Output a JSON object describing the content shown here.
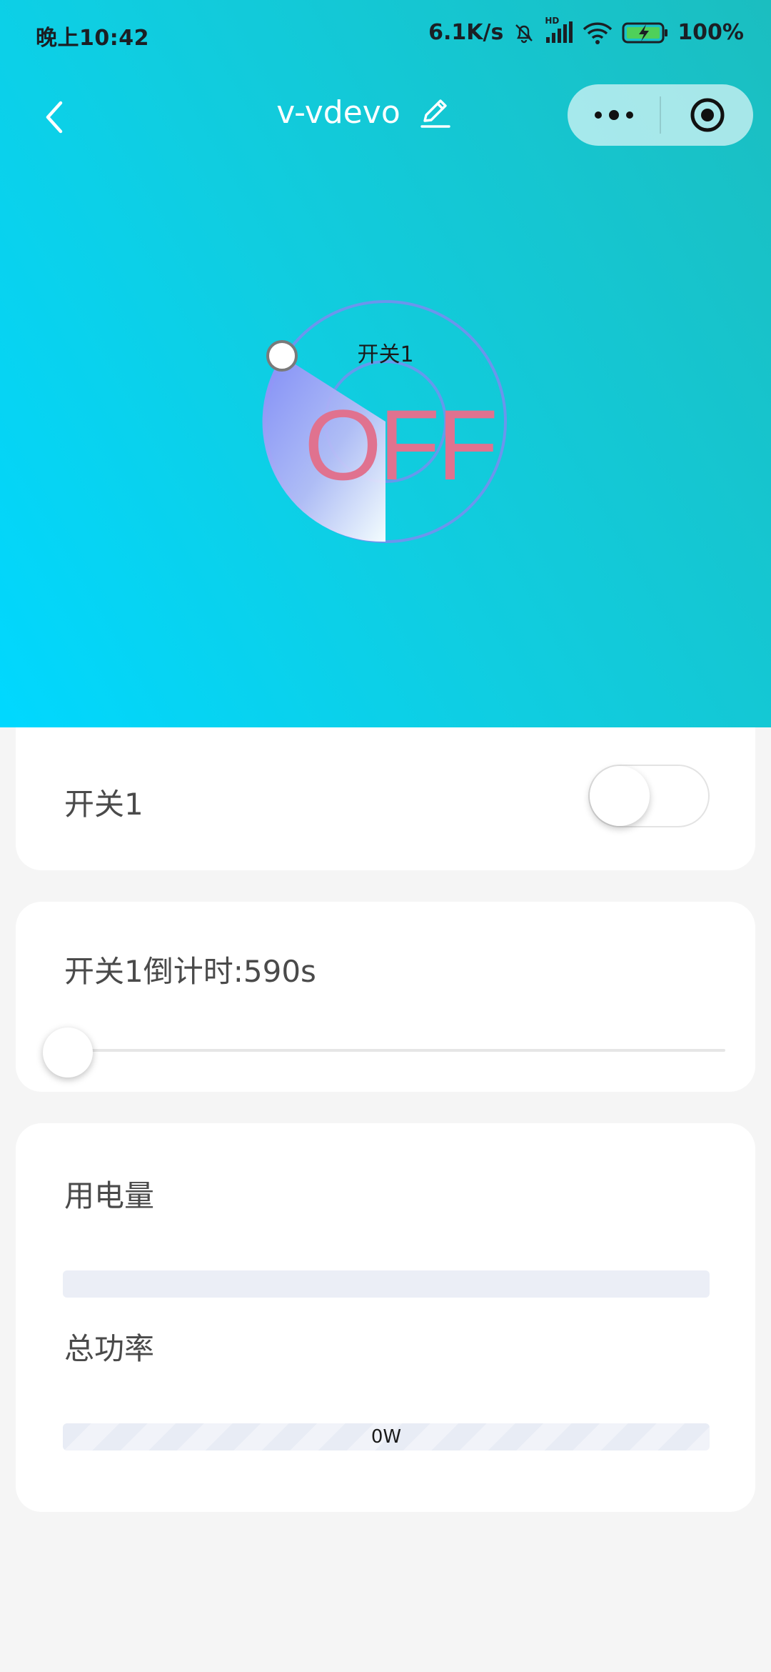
{
  "status_bar": {
    "time": "晚上10:42",
    "network_speed": "6.1K/s",
    "signal_badge": "HD",
    "battery": "100%",
    "icons": [
      "bell-mute-icon",
      "signal-icon",
      "wifi-icon",
      "battery-charging-icon"
    ]
  },
  "nav": {
    "title": "v-vdevo",
    "icons": [
      "back-arrow-icon",
      "edit-pencil-icon",
      "more-dots-icon",
      "close-target-icon"
    ]
  },
  "dial": {
    "label": "开关1",
    "state": "OFF"
  },
  "switch_card": {
    "label": "开关1",
    "toggle_on": false
  },
  "timer_card": {
    "label": "开关1倒计时:590s",
    "slider_fraction": 0
  },
  "power_card": {
    "energy_label": "用电量",
    "energy_fraction": 0,
    "power_label": "总功率",
    "power_value": "0W",
    "power_fraction": 0
  },
  "colors": {
    "hero_gradient_start": "#00d8ff",
    "hero_gradient_end": "#1bbec0",
    "dial_state": "#e0728f",
    "dial_ring": "#7b8cf0",
    "accent": "#1ab3c8",
    "card_background": "#ffffff",
    "page_background": "#f5f5f5"
  }
}
